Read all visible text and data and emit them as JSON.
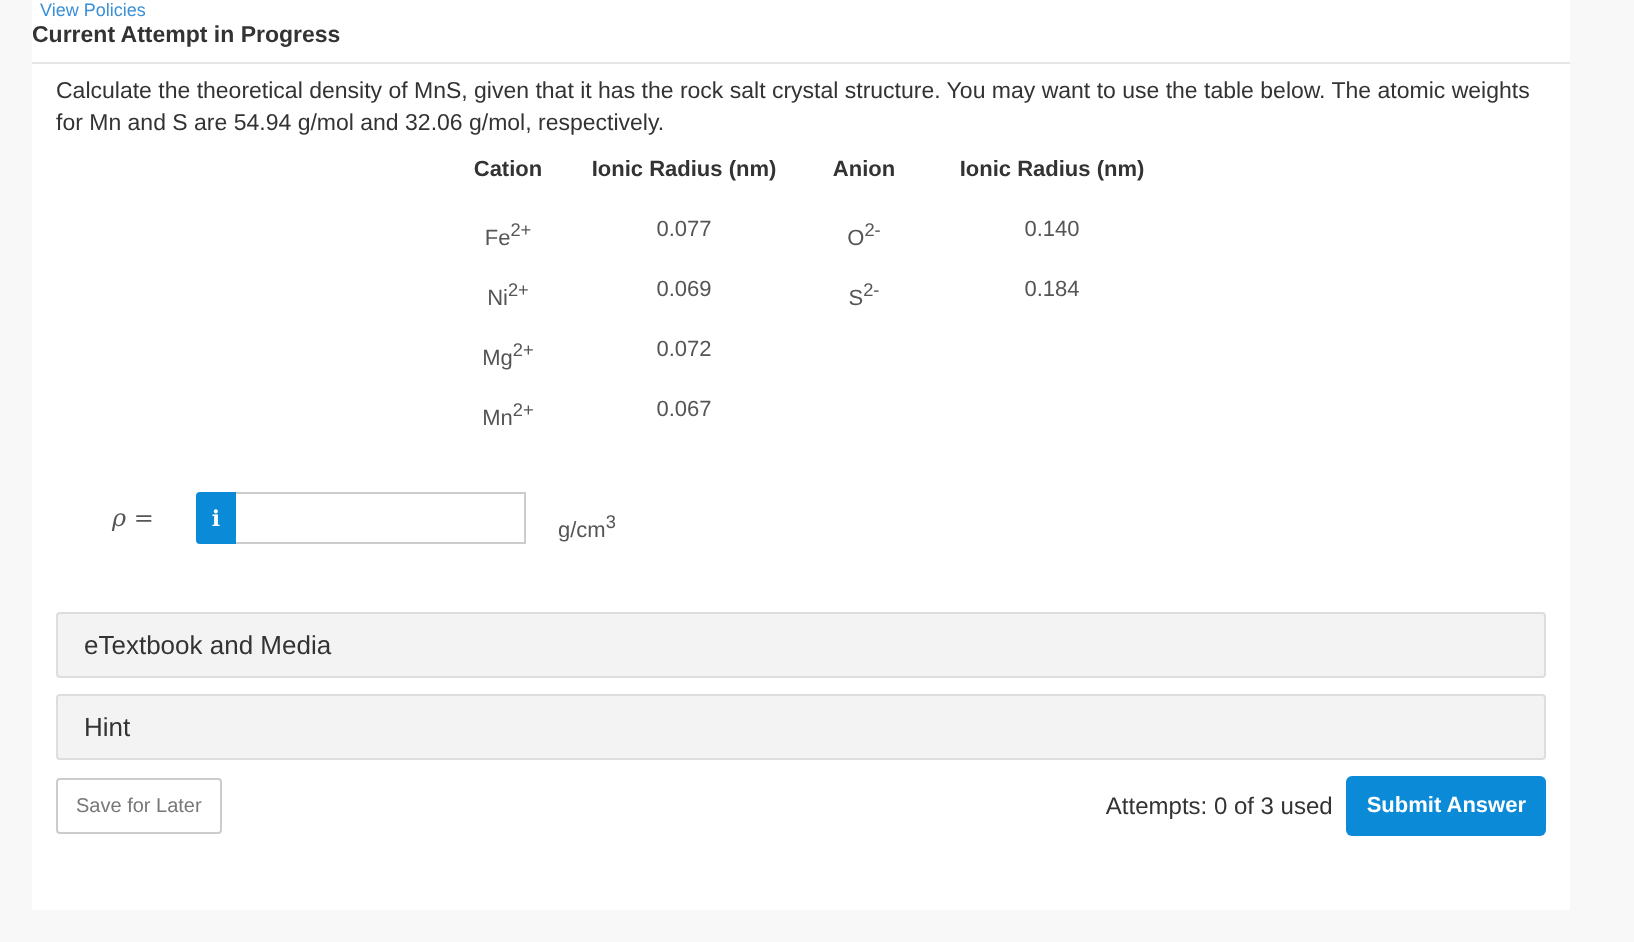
{
  "top_link": "View Policies",
  "heading": "Current Attempt in Progress",
  "question": "Calculate the theoretical density of MnS, given that it has the rock salt crystal structure. You may want to use the table below. The atomic weights for Mn and S are 54.94 g/mol and 32.06 g/mol, respectively.",
  "table": {
    "columns": [
      "Cation",
      "Ionic Radius (nm)",
      "Anion",
      "Ionic Radius (nm)"
    ],
    "rows": [
      [
        "Fe$^{2+}$",
        "0.077",
        "O$^{2-}$",
        "0.140"
      ],
      [
        "Ni$^{2+}$",
        "0.069",
        "S$^{2-}$",
        "0.184"
      ],
      [
        "Mg$^{2+}$",
        "0.072",
        "",
        ""
      ],
      [
        "Mn$^{2+}$",
        "0.067",
        "",
        ""
      ]
    ]
  },
  "answer": {
    "label": "ρ =",
    "info": "i",
    "unit": "g/cm$^{3}$"
  },
  "panels": [
    {
      "label": "eTextbook and Media"
    },
    {
      "label": "Hint"
    }
  ],
  "footer": {
    "save": "Save for Later",
    "attempts": "Attempts: 0 of 3 used",
    "submit": "Submit Answer"
  }
}
